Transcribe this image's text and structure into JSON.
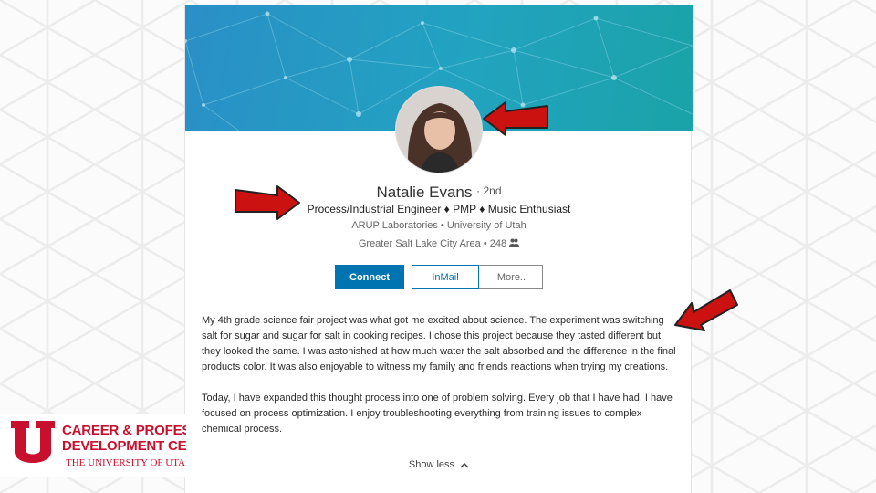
{
  "profile": {
    "name": "Natalie Evans",
    "degree": "2nd",
    "headline": "Process/Industrial Engineer ♦ PMP ♦ Music Enthusiast",
    "company": "ARUP Laboratories",
    "school": "University of Utah",
    "location": "Greater Salt Lake City Area",
    "connections": "248"
  },
  "actions": {
    "connect": "Connect",
    "inmail": "InMail",
    "more": "More..."
  },
  "about": {
    "paragraph_1": "My 4th grade science fair project was what got me excited about science. The experiment was switching salt for sugar and sugar for salt in cooking recipes. I chose this project because they tasted different but they looked the same. I was astonished at how much water the salt absorbed and the difference in the final products color. It was also enjoyable to witness my family and friends reactions when trying my creations.",
    "paragraph_2": "Today, I have expanded this thought process into one of problem solving. Every job that I have had, I have focused on process optimization. I enjoy troubleshooting everything from training issues to complex chemical process.",
    "show_less": "Show less"
  },
  "logo": {
    "line_1": "CAREER & PROFESSI",
    "line_2": "DEVELOPMENT CENT",
    "university": "THE UNIVERSITY OF UTAH"
  },
  "colors": {
    "accent_blue": "#0073b1",
    "arrow_red": "#cc1111",
    "utah_red": "#c8102e"
  }
}
